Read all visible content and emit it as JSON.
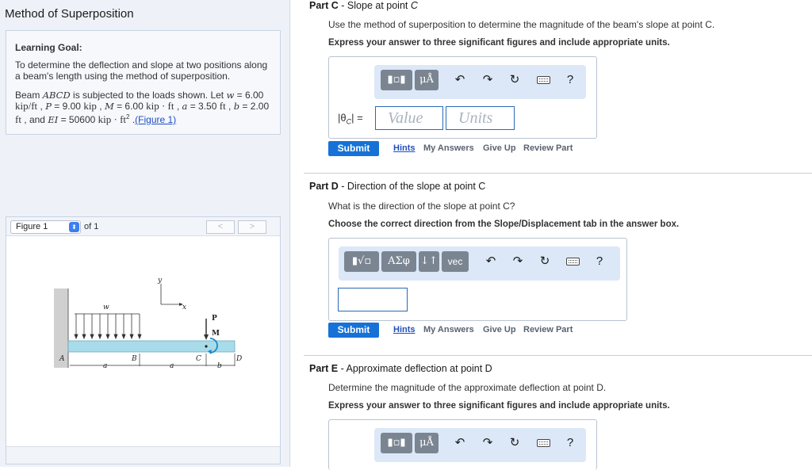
{
  "app_title": "Method of Superposition",
  "learning_goal": {
    "heading": "Learning Goal:",
    "text": "To determine the deflection and slope at two positions along a beam's length using the method of superposition."
  },
  "problem": {
    "p1": "Beam ",
    "beam_name": "ABCD",
    "p2": " is subjected to the loads shown. Let ",
    "w_sym": "w",
    "w_val": " = 6.00 ",
    "w_unit": "kip/ft",
    "p3": " , ",
    "P_sym": "P",
    "P_val": " = 9.00 ",
    "P_unit": "kip",
    "p4": " , ",
    "M_sym": "M",
    "M_val": " = 6.00 ",
    "M_unit": "kip · ft",
    "p5": " , ",
    "a_sym": "a",
    "a_val": " = 3.50 ",
    "a_unit": "ft",
    "p6": " , ",
    "b_sym": "b",
    "b_val": " = 2.00 ",
    "b_unit": "ft",
    "p7": " , and ",
    "EI_sym": "EI",
    "EI_val": " = 50600 ",
    "EI_unit": "kip · ft",
    "EI_exp": "2",
    "p8": " .",
    "figure_link": "(Figure 1)"
  },
  "figure_panel": {
    "select_value": "Figure 1",
    "of_text": "of 1",
    "prev": "<",
    "next": ">",
    "labels": {
      "y": "y",
      "x": "x",
      "w": "w",
      "P": "P",
      "M": "M",
      "A": "A",
      "B": "B",
      "C": "C",
      "D": "D",
      "a1": "a",
      "a2": "a",
      "b": "b"
    }
  },
  "part_c": {
    "label": "Part C",
    "title": " - Slope at point ",
    "point": "C",
    "question": "Use the method of superposition to determine the magnitude of the beam's slope at point C.",
    "instruction": "Express your answer to three significant figures and include appropriate units.",
    "tools": {
      "units": "μÅ",
      "help": "?"
    },
    "input_label": "|θ",
    "input_sub": "C",
    "input_label_end": "| =",
    "value_placeholder": "Value",
    "units_placeholder": "Units"
  },
  "part_d": {
    "label": "Part D",
    "title": " - Direction of the slope at point C",
    "question": "What is the direction of the slope at point C?",
    "instruction": "Choose the correct direction from the Slope/Displacement tab in the answer box.",
    "tools": {
      "greek": "ΑΣφ",
      "arrows": "↓↑",
      "vec": "vec",
      "help": "?"
    }
  },
  "part_e": {
    "label": "Part E",
    "title": " - Approximate deflection at point D",
    "question": "Determine the magnitude of the approximate deflection at point D.",
    "instruction": "Express your answer to three significant figures and include appropriate units.",
    "tools": {
      "units": "μÅ",
      "help": "?"
    }
  },
  "actions": {
    "submit": "Submit",
    "hints": "Hints",
    "my_answers": "My Answers",
    "give_up": "Give Up",
    "review_part": "Review Part"
  },
  "colors": {
    "submit": "#1672d6",
    "toolbar": "#dce8f8",
    "beam": "#a9dcea",
    "link": "#1f4fbf"
  }
}
